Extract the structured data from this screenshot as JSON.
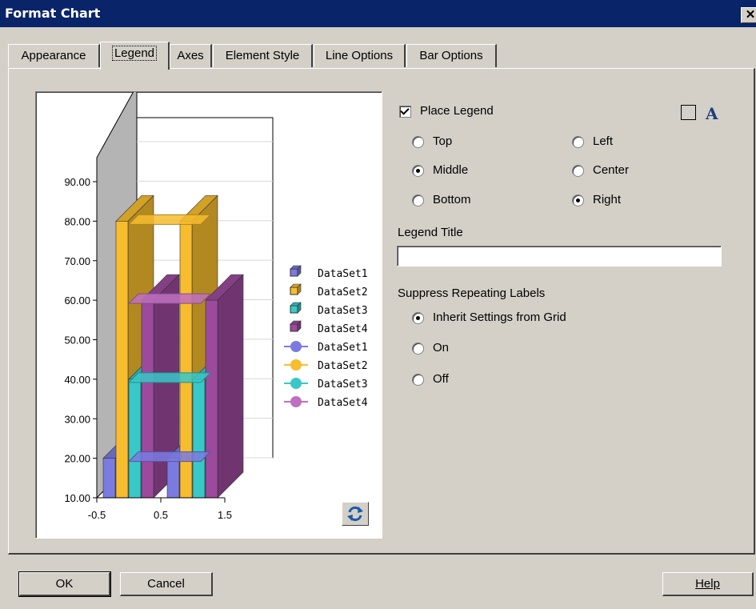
{
  "window": {
    "title": "Format Chart",
    "close_label": "✕"
  },
  "tabs": [
    {
      "label": "Appearance",
      "active": false
    },
    {
      "label": "Legend",
      "active": true
    },
    {
      "label": "Axes",
      "active": false
    },
    {
      "label": "Element Style",
      "active": false
    },
    {
      "label": "Line Options",
      "active": false
    },
    {
      "label": "Bar Options",
      "active": false
    }
  ],
  "legend_options": {
    "place_legend_label": "Place Legend",
    "place_legend_checked": true,
    "vertical": [
      {
        "label": "Top",
        "selected": false
      },
      {
        "label": "Middle",
        "selected": true
      },
      {
        "label": "Bottom",
        "selected": false
      }
    ],
    "horizontal": [
      {
        "label": "Left",
        "selected": false
      },
      {
        "label": "Center",
        "selected": false
      },
      {
        "label": "Right",
        "selected": true
      }
    ],
    "legend_title_label": "Legend Title",
    "legend_title_value": "",
    "suppress_label": "Suppress Repeating Labels",
    "suppress_options": [
      {
        "label": "Inherit Settings from Grid",
        "selected": true
      },
      {
        "label": "On",
        "selected": false
      },
      {
        "label": "Off",
        "selected": false
      }
    ],
    "font_button_checked": false,
    "font_icon": "A"
  },
  "buttons": {
    "ok": "OK",
    "cancel": "Cancel",
    "help": "Help"
  },
  "chart_data": {
    "type": "bar",
    "x_ticks": [
      "-0.5",
      "0.5",
      "1.5"
    ],
    "y_ticks": [
      "10.00",
      "20.00",
      "30.00",
      "40.00",
      "50.00",
      "60.00",
      "70.00",
      "80.00",
      "90.00"
    ],
    "ylim": [
      10,
      90
    ],
    "categories": [
      0,
      1
    ],
    "series": [
      {
        "name": "DataSet1",
        "color": "#7a7ae0",
        "values": [
          20,
          20
        ]
      },
      {
        "name": "DataSet2",
        "color": "#f7bd2e",
        "values": [
          80,
          80
        ]
      },
      {
        "name": "DataSet3",
        "color": "#38c8c8",
        "values": [
          40,
          40
        ]
      },
      {
        "name": "DataSet4",
        "color": "#9c4a9c",
        "values": [
          60,
          60
        ]
      }
    ],
    "line_series": [
      {
        "name": "DataSet1",
        "color": "#7a7ae0",
        "value": 20
      },
      {
        "name": "DataSet2",
        "color": "#f7bd2e",
        "value": 80
      },
      {
        "name": "DataSet3",
        "color": "#38c8c8",
        "value": 40
      },
      {
        "name": "DataSet4",
        "color": "#c070c0",
        "value": 60
      }
    ],
    "legend_position": "right",
    "three_d": true
  }
}
